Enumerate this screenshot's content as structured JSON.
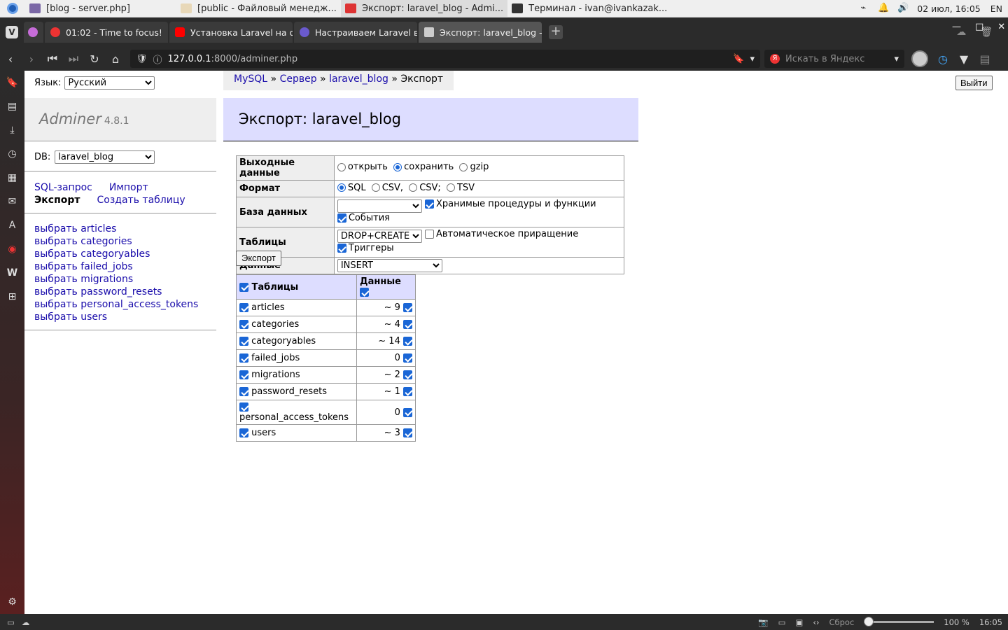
{
  "os": {
    "windows": [
      {
        "title": "[blog - server.php]",
        "color": "#7b68a6"
      },
      {
        "title": "[public - Файловый менедж...",
        "color": "#e8d8b8"
      },
      {
        "title": "Экспорт: laravel_blog - Admi...",
        "color": "#d33"
      },
      {
        "title": "Терминал - ivan@ivankazak...",
        "color": "#333"
      }
    ],
    "clock": "02 июл, 16:05",
    "lang": "EN"
  },
  "browser": {
    "tabs": [
      {
        "title": "01:02 - Time to focus!",
        "color": "#e33"
      },
      {
        "title": "Установка Laravel на обы",
        "color": "#f00"
      },
      {
        "title": "Настраиваем Laravel в ко",
        "color": "#6a5acd"
      },
      {
        "title": "Экспорт: laravel_blog - Adr",
        "color": "#ccc"
      }
    ],
    "url_host": "127.0.0.1",
    "url_rest": ":8000/adminer.php",
    "search_placeholder": "Искать в Яндекс",
    "status": {
      "reset": "Сброс",
      "zoom": "100 %",
      "time": "16:05"
    }
  },
  "adminer": {
    "lang_label": "Язык:",
    "lang_value": "Русский",
    "brand": "Adminer",
    "version": "4.8.1",
    "db_label": "DB:",
    "db_value": "laravel_blog",
    "menu": {
      "sql": "SQL-запрос",
      "import": "Импорт",
      "export": "Экспорт",
      "create": "Создать таблицу"
    },
    "table_links": [
      "выбрать articles",
      "выбрать categories",
      "выбрать categoryables",
      "выбрать failed_jobs",
      "выбрать migrations",
      "выбрать password_resets",
      "выбрать personal_access_tokens",
      "выбрать users"
    ],
    "breadcrumbs": {
      "mysql": "MySQL",
      "server": "Сервер",
      "db": "laravel_blog",
      "current": "Экспорт",
      "sep": "»"
    },
    "logout": "Выйти",
    "heading": "Экспорт: laravel_blog",
    "options": {
      "output_label": "Выходные данные",
      "output": [
        {
          "label": "открыть",
          "on": false
        },
        {
          "label": "сохранить",
          "on": true
        },
        {
          "label": "gzip",
          "on": false
        }
      ],
      "format_label": "Формат",
      "format": [
        {
          "label": "SQL",
          "on": true
        },
        {
          "label": "CSV,",
          "on": false
        },
        {
          "label": "CSV;",
          "on": false
        },
        {
          "label": "TSV",
          "on": false
        }
      ],
      "database_label": "База данных",
      "database_value": "",
      "routines_label": "Хранимые процедуры и функции",
      "events_label": "События",
      "tables_label": "Таблицы",
      "tables_value": "DROP+CREATE",
      "autoinc_label": "Автоматическое приращение",
      "triggers_label": "Триггеры",
      "data_label": "Данные",
      "data_value": "INSERT"
    },
    "export_button": "Экспорт",
    "table_header": {
      "tables": "Таблицы",
      "data": "Данные"
    },
    "tables": [
      {
        "name": "articles",
        "rows": "~ 9"
      },
      {
        "name": "categories",
        "rows": "~ 4"
      },
      {
        "name": "categoryables",
        "rows": "~ 14"
      },
      {
        "name": "failed_jobs",
        "rows": "0"
      },
      {
        "name": "migrations",
        "rows": "~ 2"
      },
      {
        "name": "password_resets",
        "rows": "~ 1"
      },
      {
        "name": "personal_access_tokens",
        "rows": "0"
      },
      {
        "name": "users",
        "rows": "~ 3"
      }
    ]
  }
}
